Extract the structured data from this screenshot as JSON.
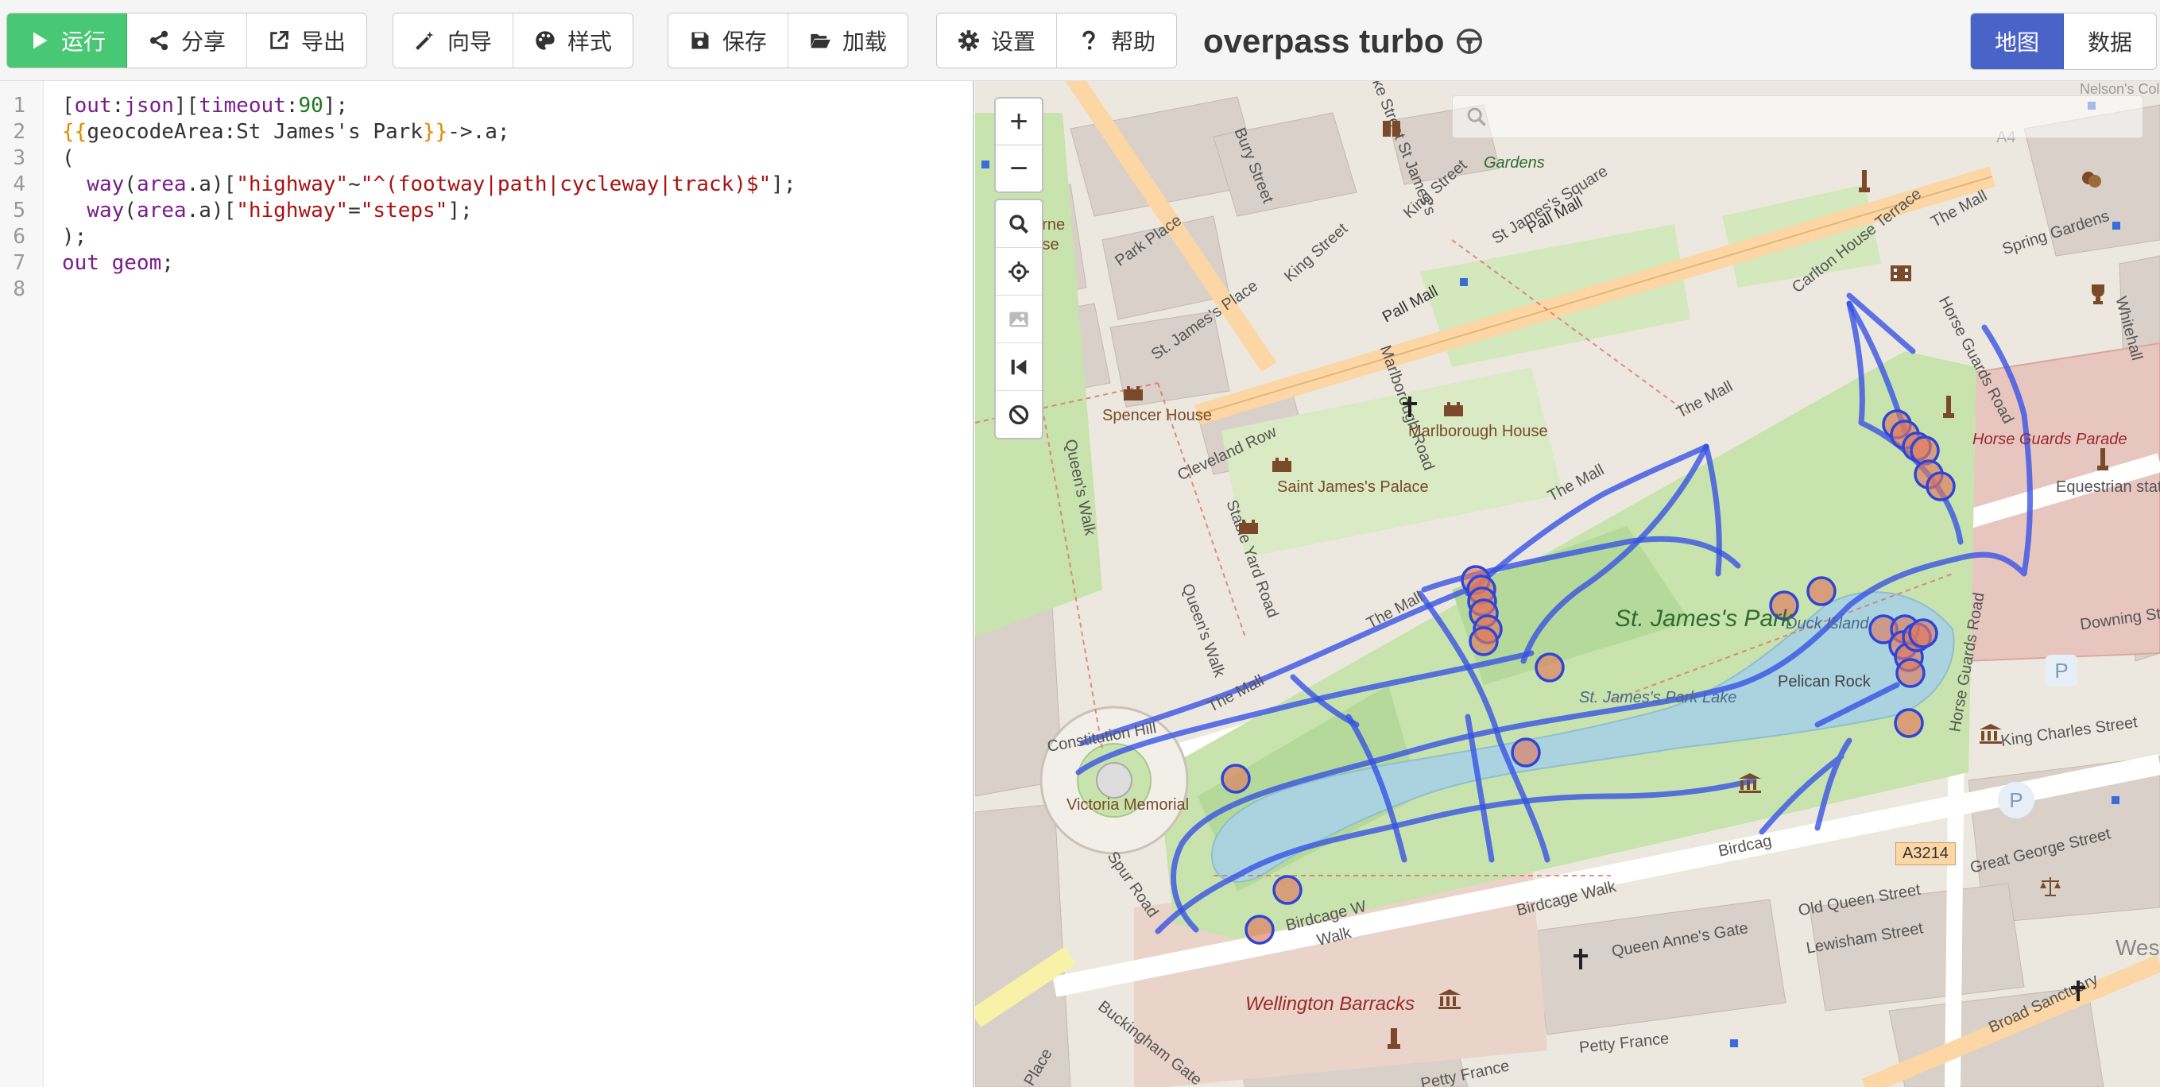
{
  "toolbar": {
    "run": "运行",
    "share": "分享",
    "export": "导出",
    "wizard": "向导",
    "style": "样式",
    "save": "保存",
    "load": "加载",
    "settings": "设置",
    "help": "帮助",
    "title": "overpass turbo",
    "view_map": "地图",
    "view_data": "数据"
  },
  "editor": {
    "line_numbers": [
      "1",
      "2",
      "3",
      "4",
      "5",
      "6",
      "7",
      "8"
    ],
    "lines": [
      [
        {
          "t": "[",
          "c": "def"
        },
        {
          "t": "out",
          "c": "kw"
        },
        {
          "t": ":",
          "c": "def"
        },
        {
          "t": "json",
          "c": "kw"
        },
        {
          "t": "][",
          "c": "def"
        },
        {
          "t": "timeout",
          "c": "kw"
        },
        {
          "t": ":",
          "c": "def"
        },
        {
          "t": "90",
          "c": "num"
        },
        {
          "t": "];",
          "c": "def"
        }
      ],
      [
        {
          "t": "{{",
          "c": "tmpl"
        },
        {
          "t": "geocodeArea:St James's Park",
          "c": "def"
        },
        {
          "t": "}}",
          "c": "tmpl"
        },
        {
          "t": "->.a;",
          "c": "def"
        }
      ],
      [
        {
          "t": "(",
          "c": "def"
        }
      ],
      [
        {
          "t": "  way",
          "c": "kw"
        },
        {
          "t": "(",
          "c": "def"
        },
        {
          "t": "area",
          "c": "kw"
        },
        {
          "t": ".a)[",
          "c": "def"
        },
        {
          "t": "\"highway\"",
          "c": "str"
        },
        {
          "t": "~",
          "c": "def"
        },
        {
          "t": "\"^(footway|path|cycleway|track)$\"",
          "c": "str"
        },
        {
          "t": "];",
          "c": "def"
        }
      ],
      [
        {
          "t": "  way",
          "c": "kw"
        },
        {
          "t": "(",
          "c": "def"
        },
        {
          "t": "area",
          "c": "kw"
        },
        {
          "t": ".a)[",
          "c": "def"
        },
        {
          "t": "\"highway\"",
          "c": "str"
        },
        {
          "t": "=",
          "c": "def"
        },
        {
          "t": "\"steps\"",
          "c": "str"
        },
        {
          "t": "];",
          "c": "def"
        }
      ],
      [
        {
          "t": ");",
          "c": "def"
        }
      ],
      [
        {
          "t": "out geom",
          "c": "kw"
        },
        {
          "t": ";",
          "c": "def"
        }
      ],
      []
    ]
  },
  "map": {
    "zoom_in": "+",
    "zoom_out": "−",
    "labels": {
      "st_james_park": "St. James's Park",
      "lake": "St. James's Park Lake",
      "duck_island": "Duck Island",
      "pelican_rock": "Pelican Rock",
      "birdcage_walk": "Birdcage Walk",
      "birdcage_w": "Birdcage W",
      "walk": "Walk",
      "birdcag": "Birdcag",
      "the_mall_1": "The Mall",
      "the_mall_2": "The Mall",
      "the_mall_3": "The Mall",
      "the_mall_4": "The Mall",
      "the_mall_5": "The Mall",
      "pall_mall_1": "Pall Mall",
      "pall_mall_2": "Pall Mall",
      "spencer_house": "Spencer House",
      "st_james_palace": "Saint James's Palace",
      "marlborough_house": "Marlborough House",
      "victoria_memorial": "Victoria Memorial",
      "constitution_hill": "Constitution Hill",
      "spur_road": "Spur Road",
      "queens_walk_1": "Queen's Walk",
      "queens_walk_2": "Queen's Walk",
      "stable_yard_road": "Stable Yard Road",
      "cleveland_row": "Cleveland Row",
      "marlborough_road": "Marlborough Road",
      "horse_guards_road_1": "Horse Guards Road",
      "horse_guards_road_2": "Horse Guards Road",
      "horse_guards_parade": "Horse Guards Parade",
      "equestrian_statue": "Equestrian statue of the Earl Roberts",
      "downing_street": "Downing Street",
      "king_charles_street": "King Charles Street",
      "great_george_street": "Great George Street",
      "old_queen_street": "Old Queen Street",
      "queen_annes_gate": "Queen Anne's Gate",
      "lewisham_street": "Lewisham Street",
      "wellington_barracks": "Wellington Barracks",
      "buckingham_gate": "Buckingham Gate",
      "petty_france_1": "Petty France",
      "petty_france_2": "Petty France",
      "broad_sanctuary": "Broad Sanctuary",
      "carlton_house_terrace": "Carlton House Terrace",
      "spring_gardens": "Spring Gardens",
      "whitehall": "Whitehall",
      "king_street_1": "King Street",
      "king_street_2": "King Street",
      "bury_street": "Bury Street",
      "duke_street": "Duke Street St James's",
      "st_james_square": "St James's Square",
      "park_place": "Park Place",
      "st_james_place": "St. James's Place",
      "gardens": "Gardens",
      "a3214": "A3214",
      "a4": "A4",
      "westm": "Westm",
      "place": "Place",
      "nelsons_column": "Nelson's Column",
      "ourne": "ourne",
      "ise": "ise"
    }
  }
}
